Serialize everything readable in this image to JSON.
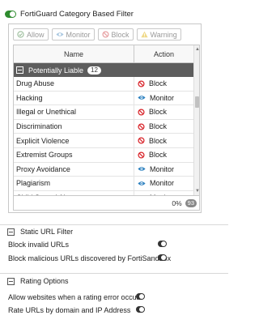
{
  "header": {
    "title": "FortiGuard Category Based Filter"
  },
  "toolbar": {
    "allow": "Allow",
    "monitor": "Monitor",
    "block": "Block",
    "warning": "Warning"
  },
  "table": {
    "col_name": "Name",
    "col_action": "Action",
    "group": {
      "label": "Potentially Liable",
      "count": "12"
    },
    "rows": [
      {
        "name": "Drug Abuse",
        "action": "Block"
      },
      {
        "name": "Hacking",
        "action": "Monitor"
      },
      {
        "name": "Illegal or Unethical",
        "action": "Block"
      },
      {
        "name": "Discrimination",
        "action": "Block"
      },
      {
        "name": "Explicit Violence",
        "action": "Block"
      },
      {
        "name": "Extremist Groups",
        "action": "Block"
      },
      {
        "name": "Proxy Avoidance",
        "action": "Monitor"
      },
      {
        "name": "Plagiarism",
        "action": "Monitor"
      },
      {
        "name": "Child Sexual Abuse",
        "action": "Monitor"
      }
    ],
    "footer_percent": "0%",
    "footer_count": "93"
  },
  "static_url": {
    "title": "Static URL Filter",
    "opt1": "Block invalid URLs",
    "opt2": "Block malicious URLs discovered by FortiSandbox"
  },
  "rating": {
    "title": "Rating Options",
    "opt1": "Allow websites when a rating error occurs",
    "opt2": "Rate URLs by domain and IP Address"
  },
  "colors": {
    "block": "#d9262c",
    "monitor": "#2a7fbf",
    "allow": "#2e8b2e",
    "warning": "#e0b000",
    "group_bg": "#5d5d5d"
  }
}
